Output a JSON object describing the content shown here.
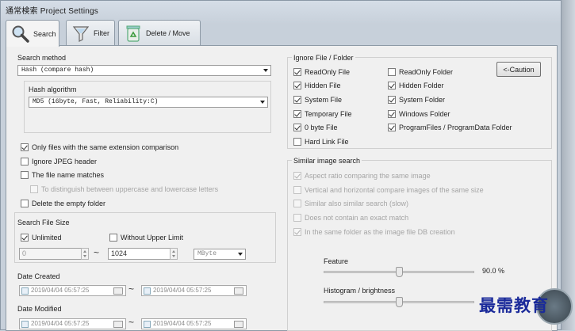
{
  "window": {
    "title": "通常検索 Project Settings"
  },
  "tabs": [
    {
      "label": "Search",
      "icon": "magnifier-icon"
    },
    {
      "label": "Filter",
      "icon": "filter-icon"
    },
    {
      "label": "Delete / Move",
      "icon": "recycle-icon"
    }
  ],
  "search_method": {
    "label": "Search method",
    "value": "Hash     (compare hash)",
    "hash_algorithm_label": "Hash algorithm",
    "hash_algorithm_value": "MD5     (16byte, Fast, Reliability:C)"
  },
  "options": [
    {
      "label": "Only files with the same extension comparison",
      "checked": true
    },
    {
      "label": "Ignore JPEG header",
      "checked": false
    },
    {
      "label": "The file name matches",
      "checked": false
    },
    {
      "label": "To distinguish between uppercase and lowercase letters",
      "checked": false,
      "disabled": true
    },
    {
      "label": "Delete the empty folder",
      "checked": false
    }
  ],
  "file_size": {
    "label": "Search File Size",
    "unlimited_label": "Unlimited",
    "unlimited_checked": true,
    "no_upper_label": "Without Upper Limit",
    "no_upper_checked": false,
    "min_value": "0",
    "tilde": "~",
    "max_value": "1024",
    "unit": "MByte"
  },
  "date_created": {
    "label": "Date Created",
    "from": "2019/04/04 05:57:25",
    "to": "2019/04/04 05:57:25"
  },
  "date_modified": {
    "label": "Date Modified",
    "from": "2019/04/04 05:57:25",
    "to": "2019/04/04 05:57:25"
  },
  "ignore": {
    "label": "Ignore File / Folder",
    "caution_button": "<-Caution",
    "left": [
      {
        "label": "ReadOnly File",
        "checked": true
      },
      {
        "label": "Hidden File",
        "checked": true
      },
      {
        "label": "System File",
        "checked": true
      },
      {
        "label": "Temporary File",
        "checked": true
      },
      {
        "label": "0 byte File",
        "checked": true
      },
      {
        "label": "Hard Link File",
        "checked": false
      }
    ],
    "right": [
      {
        "label": "ReadOnly Folder",
        "checked": false
      },
      {
        "label": "Hidden Folder",
        "checked": true
      },
      {
        "label": "System Folder",
        "checked": true
      },
      {
        "label": "Windows Folder",
        "checked": true
      },
      {
        "label": "ProgramFiles / ProgramData Folder",
        "checked": true
      }
    ]
  },
  "similar": {
    "label": "Similar image search",
    "items": [
      {
        "label": "Aspect ratio comparing the same image",
        "checked": true
      },
      {
        "label": "Vertical and horizontal compare images of the same size",
        "checked": false
      },
      {
        "label": "Similar also similar search (slow)",
        "checked": false
      },
      {
        "label": "Does not contain an exact match",
        "checked": false
      },
      {
        "label": "In the same folder as the image file DB creation",
        "checked": true
      }
    ],
    "feature_label": "Feature",
    "feature_value": "90.0 %",
    "feature_level": 0.5,
    "histogram_label": "Histogram / brightness",
    "histogram_level": 0.5
  },
  "watermark": "最需教育"
}
